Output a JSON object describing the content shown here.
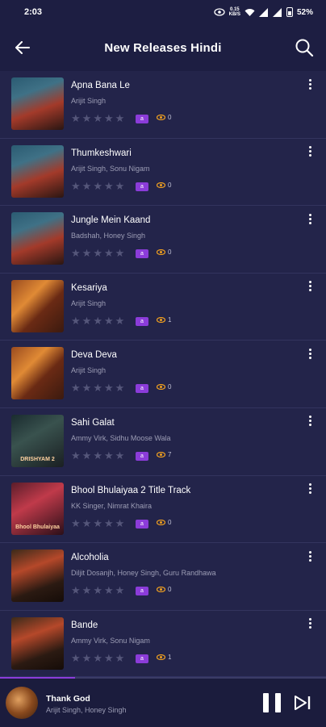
{
  "status": {
    "time": "2:03",
    "net_speed": "0.15",
    "net_unit": "KB/S",
    "battery": "52%"
  },
  "appbar": {
    "title": "New Releases Hindi"
  },
  "songs": [
    {
      "title": "Apna Bana Le",
      "artist": "Arijit Singh",
      "views": "0",
      "badge": "a",
      "rating": 0
    },
    {
      "title": "Thumkeshwari",
      "artist": "Arijit Singh, Sonu Nigam",
      "views": "0",
      "badge": "a",
      "rating": 0
    },
    {
      "title": "Jungle Mein Kaand",
      "artist": "Badshah, Honey Singh",
      "views": "0",
      "badge": "a",
      "rating": 0
    },
    {
      "title": "Kesariya",
      "artist": "Arijit Singh",
      "views": "1",
      "badge": "a",
      "rating": 0
    },
    {
      "title": "Deva Deva",
      "artist": "Arijit Singh",
      "views": "0",
      "badge": "a",
      "rating": 0
    },
    {
      "title": "Sahi Galat",
      "artist": "Ammy Virk, Sidhu Moose Wala",
      "views": "7",
      "badge": "a",
      "rating": 0
    },
    {
      "title": "Bhool Bhulaiyaa 2 Title Track",
      "artist": "KK Singer, Nimrat Khaira",
      "views": "0",
      "badge": "a",
      "rating": 0
    },
    {
      "title": "Alcoholia",
      "artist": "Diljit Dosanjh, Honey Singh, Guru Randhawa",
      "views": "0",
      "badge": "a",
      "rating": 0
    },
    {
      "title": "Bande",
      "artist": "Ammy Virk, Sonu Nigam",
      "views": "1",
      "badge": "a",
      "rating": 0
    }
  ],
  "thumb_labels": {
    "drishyam": "DRISHYAM 2",
    "bhool": "Bhool Bhulaiyaa"
  },
  "player": {
    "title": "Thank God",
    "artist": "Arijit Singh, Honey Singh",
    "progress": 0.23
  },
  "colors": {
    "background": "#23244a",
    "accent": "#8b3cd9",
    "eye": "#f0a020"
  },
  "icons": {
    "back": "arrow-left-icon",
    "search": "search-icon",
    "more": "more-vert-icon",
    "views": "eye-icon",
    "pause": "pause-icon",
    "next": "skip-next-icon"
  }
}
